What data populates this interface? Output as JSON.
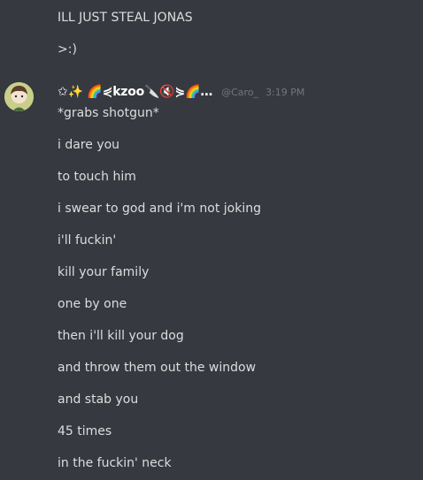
{
  "previous_messages": [
    "ILL JUST STEAL JONAS",
    ">:)"
  ],
  "message_group": {
    "avatar_icon": "user-avatar-icon",
    "username": "✩✨ 🌈⋞kzoo🔪🔇⋟🌈…",
    "handle": "@Caro_",
    "timestamp": "3:19 PM",
    "lines": [
      "*grabs shotgun*",
      "i dare you",
      "to touch him",
      "i swear to god and i'm not joking",
      "i'll fuckin'",
      "kill your family",
      "one by one",
      "then i'll kill your dog",
      "and throw them out the window",
      "and stab you",
      "45 times",
      "in the fuckin' neck"
    ]
  },
  "colors": {
    "background": "#36393f",
    "text": "#dcddde",
    "username": "#ffffff",
    "muted": "#72767d"
  }
}
